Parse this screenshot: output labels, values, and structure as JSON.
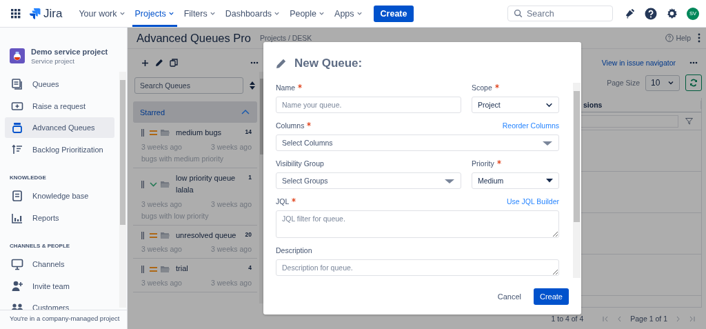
{
  "top_nav": {
    "product": "Jira",
    "items": [
      {
        "label": "Your work",
        "selected": false
      },
      {
        "label": "Projects",
        "selected": true
      },
      {
        "label": "Filters",
        "selected": false
      },
      {
        "label": "Dashboards",
        "selected": false
      },
      {
        "label": "People",
        "selected": false
      },
      {
        "label": "Apps",
        "selected": false
      }
    ],
    "create_button": "Create",
    "search": {
      "placeholder": "Search"
    },
    "avatar": "SV"
  },
  "sidebar": {
    "project": {
      "name": "Demo service project",
      "type": "Service project"
    },
    "sections": [
      {
        "items": [
          {
            "label": "Queues",
            "selected": false
          },
          {
            "label": "Raise a request",
            "selected": false
          },
          {
            "label": "Advanced Queues",
            "selected": true
          },
          {
            "label": "Backlog Prioritization",
            "selected": false
          }
        ]
      },
      {
        "heading": "KNOWLEDGE",
        "items": [
          {
            "label": "Knowledge base",
            "selected": false
          },
          {
            "label": "Reports",
            "selected": false
          }
        ]
      },
      {
        "heading": "CHANNELS & PEOPLE",
        "items": [
          {
            "label": "Channels",
            "selected": false
          },
          {
            "label": "Invite team",
            "selected": false
          },
          {
            "label": "Customers",
            "selected": false
          }
        ]
      }
    ],
    "footer": "You're in a company-managed project"
  },
  "page": {
    "title": "Advanced Queues Pro",
    "breadcrumb": "Projects / DESK",
    "help": "Help"
  },
  "queue_panel": {
    "search": {
      "placeholder": "Search Queues"
    },
    "group": {
      "label": "Starred",
      "expanded": true
    },
    "queues": [
      {
        "name": "medium bugs",
        "count": "14",
        "kind": "medium",
        "created": "3 weeks ago",
        "updated": "3 weeks ago",
        "description": "bugs with medium priority"
      },
      {
        "name": "low priority queue lalala",
        "count": "1",
        "kind": "low",
        "created": "3 weeks ago",
        "updated": "3 weeks ago",
        "description": "bugs with low priority"
      },
      {
        "name": "unresolved queue",
        "count": "20",
        "kind": "medium",
        "created": "3 weeks ago",
        "updated": "3 weeks ago"
      },
      {
        "name": "trial",
        "count": "4",
        "kind": "medium",
        "created": "3 weeks ago",
        "updated": "3 weeks ago"
      }
    ]
  },
  "results": {
    "link": "View in issue navigator",
    "page_size_label": "Page Size",
    "page_size": "10",
    "column_header": "sions",
    "summary": "1 to 4 of 4",
    "page": "Page 1 of 1"
  },
  "modal": {
    "title": "New Queue:",
    "rows": [
      [
        {
          "label": "Name",
          "required": true,
          "kind": "text",
          "placeholder": "Name your queue."
        },
        {
          "label": "Scope",
          "required": true,
          "kind": "select",
          "value": "Project"
        }
      ],
      [
        {
          "label": "Columns",
          "required": true,
          "kind": "multi",
          "placeholder": "Select Columns",
          "link": "Reorder Columns"
        }
      ],
      [
        {
          "label": "Visibility Group",
          "required": false,
          "kind": "multi",
          "placeholder": "Select Groups"
        },
        {
          "label": "Priority",
          "required": true,
          "kind": "dropdown",
          "value": "Medium"
        }
      ],
      [
        {
          "label": "JQL",
          "required": true,
          "kind": "textarea",
          "placeholder": "JQL filter for queue.",
          "link": "Use JQL Builder",
          "tall": true
        }
      ],
      [
        {
          "label": "Description",
          "required": false,
          "kind": "textarea",
          "placeholder": "Description for queue.",
          "tall": false
        }
      ]
    ],
    "cancel": "Cancel",
    "submit": "Create"
  }
}
